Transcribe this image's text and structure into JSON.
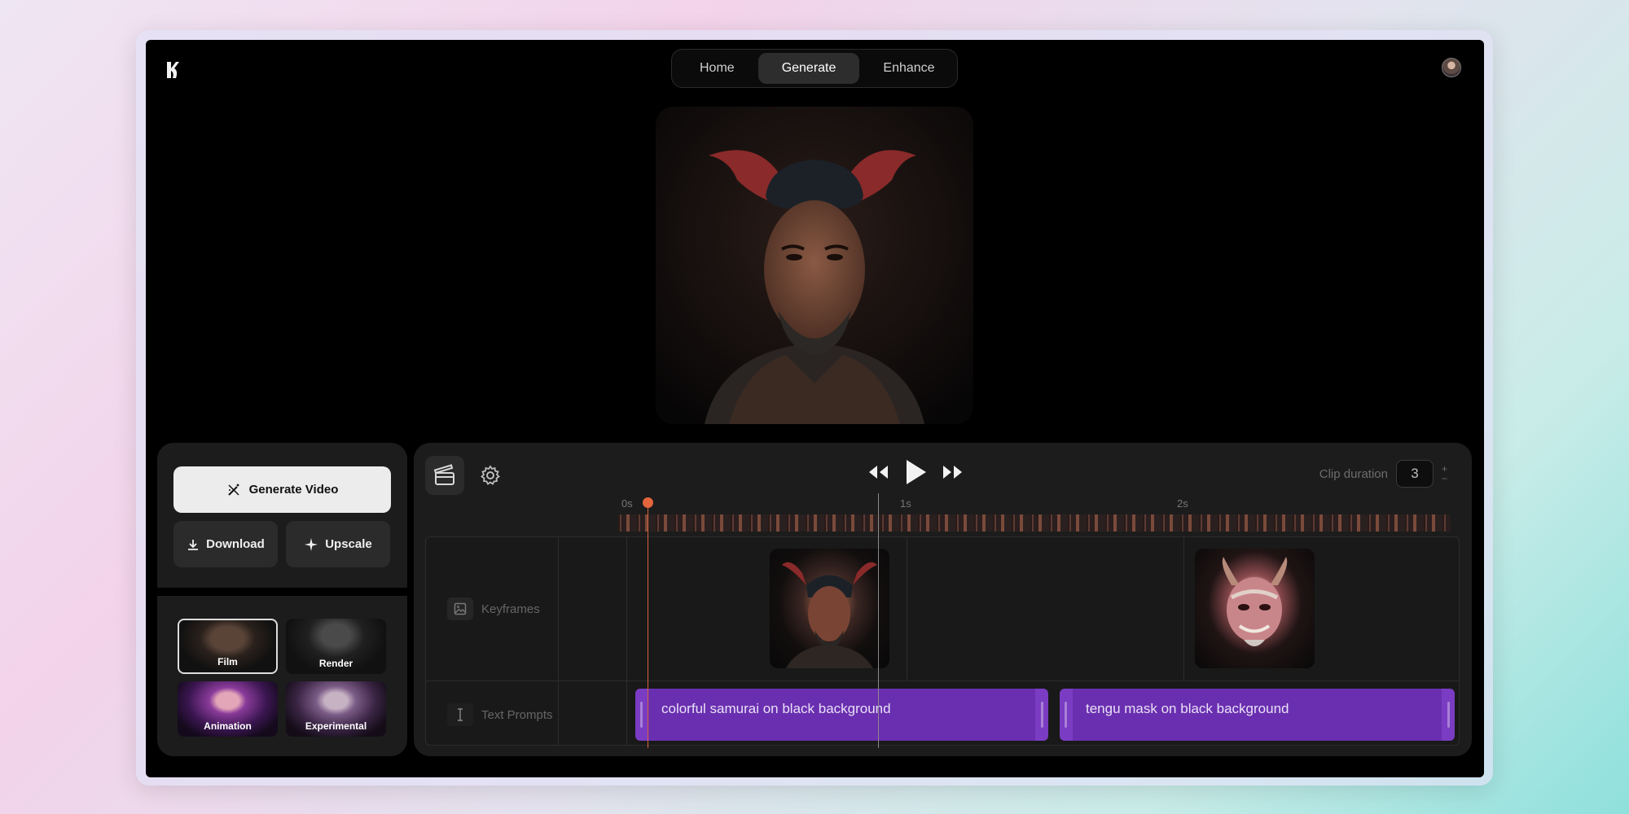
{
  "nav": {
    "tabs": [
      "Home",
      "Generate",
      "Enhance"
    ],
    "active": "Generate"
  },
  "actions": {
    "generate_label": "Generate Video",
    "download_label": "Download",
    "upscale_label": "Upscale"
  },
  "styles": [
    {
      "label": "Film",
      "selected": true
    },
    {
      "label": "Render"
    },
    {
      "label": "Animation"
    },
    {
      "label": "Experimental"
    }
  ],
  "timeline": {
    "clip_duration_label": "Clip duration",
    "clip_duration_value": "3",
    "plus": "+",
    "minus": "−",
    "ruler": [
      "0s",
      "1s",
      "2s"
    ],
    "tracks": {
      "keyframes_label": "Keyframes",
      "text_prompts_label": "Text Prompts"
    },
    "prompts": [
      "colorful samurai on black background",
      "tengu mask on black background"
    ]
  },
  "colors": {
    "accent_purple": "#6a2fb0",
    "playhead": "#e3643d",
    "background": "#000000"
  },
  "icons": [
    "logo-icon",
    "wand-icon",
    "download-icon",
    "sparkle-icon",
    "clapperboard-icon",
    "gear-icon",
    "rewind-icon",
    "play-icon",
    "fast-forward-icon",
    "image-icon",
    "text-cursor-icon"
  ]
}
